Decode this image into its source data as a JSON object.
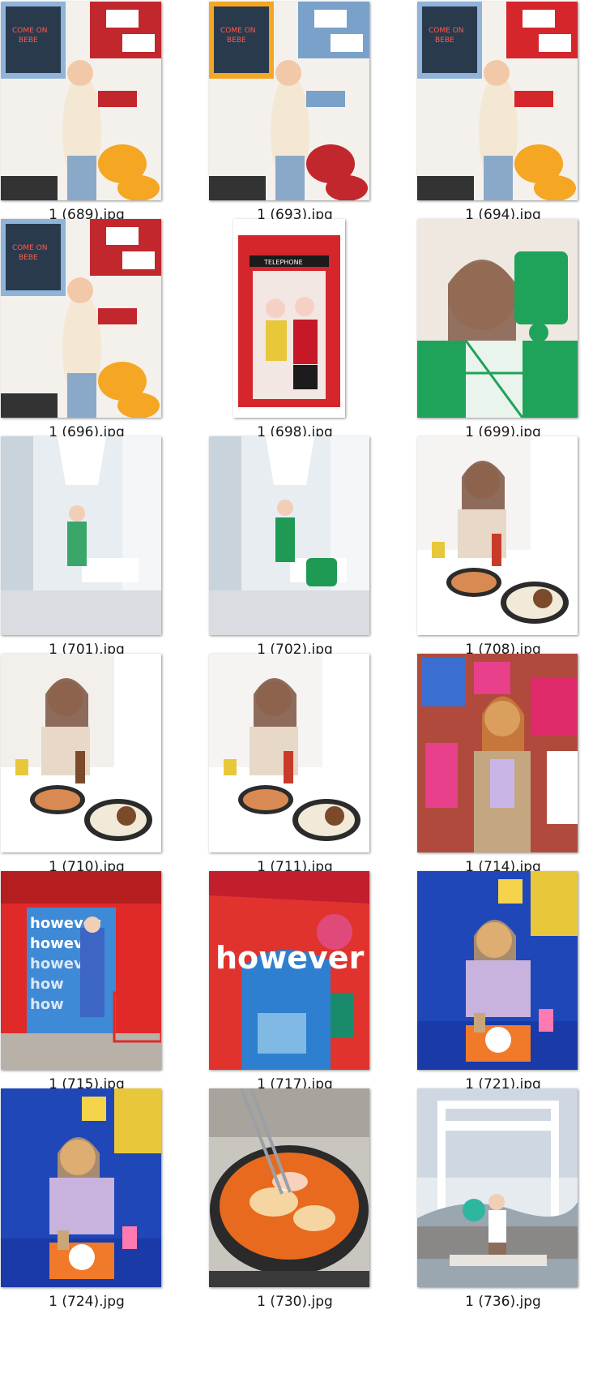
{
  "files": [
    {
      "name": "1 (689).jpg",
      "scene": "cafe-yellow-chairs-donut-box",
      "palette": [
        "#f4f1ec",
        "#f5a623",
        "#c2272d",
        "#8fb3d9"
      ]
    },
    {
      "name": "1 (693).jpg",
      "scene": "cafe-donut-box-closeup",
      "palette": [
        "#f4f1ec",
        "#c2272d",
        "#7aa1c9",
        "#f5a623"
      ]
    },
    {
      "name": "1 (694).jpg",
      "scene": "cafe-yellow-chairs-red-crate",
      "palette": [
        "#f4f1ec",
        "#f5a623",
        "#d4262b",
        "#8fb3d9"
      ]
    },
    {
      "name": "1 (696).jpg",
      "scene": "cafe-donut-box-smiling",
      "palette": [
        "#f4f1ec",
        "#f5a623",
        "#c2272d",
        "#8fb3d9"
      ]
    },
    {
      "name": "1 (698).jpg",
      "scene": "red-telephone-box",
      "palette": [
        "#ffffff",
        "#d4262b",
        "#f7d0c5",
        "#1c1c1c"
      ]
    },
    {
      "name": "1 (699).jpg",
      "scene": "selfie-green-bag",
      "palette": [
        "#efe8e0",
        "#1fa35a",
        "#d9c9b8",
        "#ffffff"
      ]
    },
    {
      "name": "1 (701).jpg",
      "scene": "white-corridor-green-dress",
      "palette": [
        "#e8edf2",
        "#ffffff",
        "#3aa66a",
        "#c9d3dc"
      ]
    },
    {
      "name": "1 (702).jpg",
      "scene": "white-corridor-bench-green-bag",
      "palette": [
        "#e8edf2",
        "#ffffff",
        "#1f9a55",
        "#c9d3dc"
      ]
    },
    {
      "name": "1 (708).jpg",
      "scene": "restaurant-table-food",
      "palette": [
        "#f6f4f2",
        "#ffffff",
        "#c83b2a",
        "#3d3d3d"
      ]
    },
    {
      "name": "1 (710).jpg",
      "scene": "restaurant-plate-closeup",
      "palette": [
        "#f3f0ec",
        "#ffffff",
        "#7a4a2a",
        "#2f7a2f"
      ]
    },
    {
      "name": "1 (711).jpg",
      "scene": "restaurant-table-seated",
      "palette": [
        "#f6f4f2",
        "#ffffff",
        "#c83b2a",
        "#3d3d3d"
      ]
    },
    {
      "name": "1 (714).jpg",
      "scene": "poster-wall-jacket",
      "palette": [
        "#b04a3c",
        "#e8408a",
        "#c4a680",
        "#3b6fd1"
      ]
    },
    {
      "name": "1 (715).jpg",
      "scene": "however-mural-entrance",
      "palette": [
        "#1f3e8a",
        "#e02a2a",
        "#3f8ad6",
        "#b7b1a8"
      ]
    },
    {
      "name": "1 (717).jpg",
      "scene": "however-brick-wall",
      "palette": [
        "#e0332e",
        "#ffffff",
        "#2e7fd0",
        "#1b8a6a"
      ]
    },
    {
      "name": "1 (721).jpg",
      "scene": "blue-cafe-drinks",
      "palette": [
        "#1f47b8",
        "#c8b3de",
        "#f07a2a",
        "#ffffff"
      ]
    },
    {
      "name": "1 (724).jpg",
      "scene": "blue-cafe-rainbow-cup",
      "palette": [
        "#1f47b8",
        "#c8b3de",
        "#f07a2a",
        "#ffffff"
      ]
    },
    {
      "name": "1 (730).jpg",
      "scene": "tteokbokki-pan",
      "palette": [
        "#2a2a2a",
        "#e86a1e",
        "#f5d6a2",
        "#9aa0a6"
      ]
    },
    {
      "name": "1 (736).jpg",
      "scene": "mountain-view-frame",
      "palette": [
        "#e6ebf0",
        "#ffffff",
        "#2eb6a0",
        "#8a6d5a"
      ]
    }
  ]
}
